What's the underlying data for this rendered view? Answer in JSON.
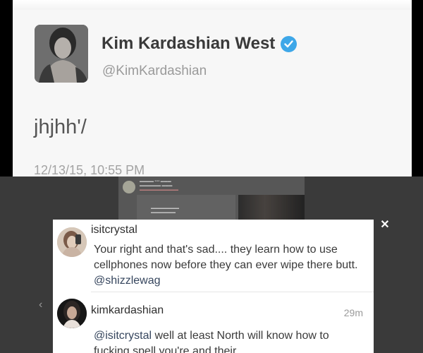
{
  "tweet": {
    "author_name": "Kim Kardashian West",
    "verified": true,
    "handle": "@KimKardashian",
    "text": "jhjhh'/",
    "timestamp": "12/13/15, 10:55 PM",
    "verified_color": "#3ea7e8"
  },
  "viewer": {
    "close_icon": "close-icon",
    "prev_icon": "chevron-left-icon",
    "comments": [
      {
        "username": "isitcrystal",
        "text": "Your right and that's sad.... they learn how to use cellphones now before they can ever wipe there butt.",
        "mention": "@shizzlewag",
        "time": ""
      },
      {
        "username": "kimkardashian",
        "mention": "@isitcrystal",
        "text": "well at least North will know how to fucking spell you're and their",
        "time": "29m"
      }
    ]
  }
}
